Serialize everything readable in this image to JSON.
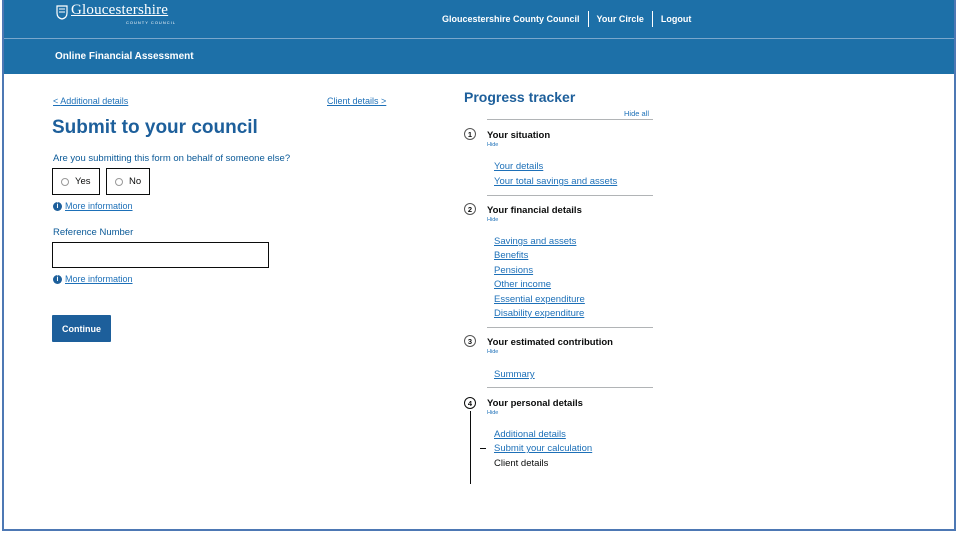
{
  "header": {
    "logo_name": "Gloucestershire",
    "logo_sub": "COUNTY COUNCIL",
    "links": [
      "Gloucestershire County Council",
      "Your Circle",
      "Logout"
    ]
  },
  "subheader": {
    "title": "Online Financial Assessment"
  },
  "nav": {
    "back": "Additional details",
    "next": "Client details"
  },
  "form": {
    "title": "Submit to your council",
    "question": "Are you submitting this form on behalf of someone else?",
    "options": [
      "Yes",
      "No"
    ],
    "more_info": "More information",
    "ref_label": "Reference Number",
    "ref_value": "",
    "continue": "Continue"
  },
  "tracker": {
    "title": "Progress tracker",
    "hide_all": "Hide all",
    "hide": "Hide",
    "steps": [
      {
        "number": "1",
        "title": "Your situation",
        "items": [
          "Your details",
          "Your total savings and assets"
        ]
      },
      {
        "number": "2",
        "title": "Your financial details",
        "items": [
          "Savings and assets",
          "Benefits",
          "Pensions",
          "Other income",
          "Essential expenditure",
          "Disability expenditure"
        ]
      },
      {
        "number": "3",
        "title": "Your estimated contribution",
        "items": [
          "Summary"
        ]
      },
      {
        "number": "4",
        "title": "Your personal details",
        "items": [
          "Additional details",
          "Submit your calculation",
          "Client details"
        ]
      }
    ]
  },
  "colors": {
    "brand": "#1d70a8",
    "heading": "#1d5f9b",
    "link": "#1d70b8"
  }
}
